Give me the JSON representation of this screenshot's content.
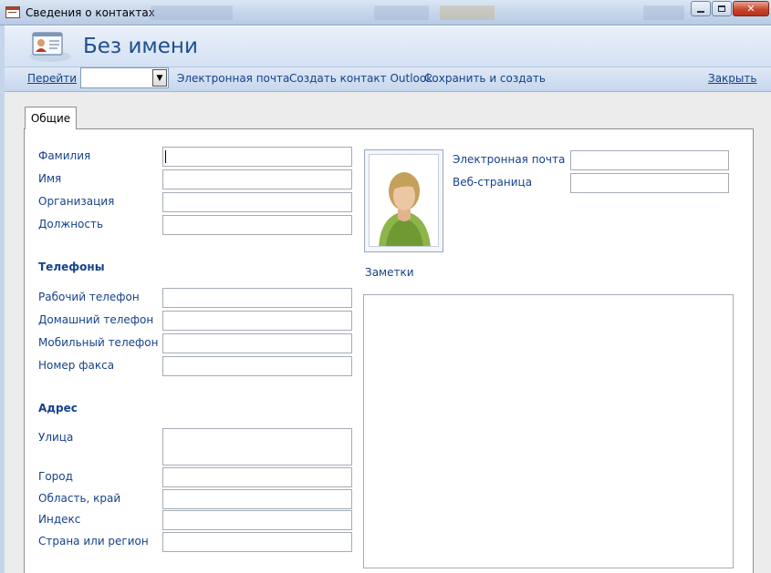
{
  "window": {
    "title": "Сведения о контактах"
  },
  "header": {
    "title": "Без имени"
  },
  "toolbar": {
    "goto_label": "Перейти",
    "goto_value": "",
    "email_label": "Электронная почта",
    "create_outlook_label": "Создать контакт Outlook",
    "save_new_label": "Сохранить и создать",
    "close_label": "Закрыть"
  },
  "tabs": [
    {
      "label": "Общие",
      "active": true
    }
  ],
  "general": {
    "last_name_label": "Фамилия",
    "first_name_label": "Имя",
    "company_label": "Организация",
    "job_title_label": "Должность",
    "last_name": "",
    "first_name": "",
    "company": "",
    "job_title": ""
  },
  "phones": {
    "section_title": "Телефоны",
    "work_label": "Рабочий телефон",
    "home_label": "Домашний телефон",
    "mobile_label": "Мобильный телефон",
    "fax_label": "Номер факса",
    "work": "",
    "home": "",
    "mobile": "",
    "fax": ""
  },
  "address": {
    "section_title": "Адрес",
    "street_label": "Улица",
    "city_label": "Город",
    "region_label": "Область, край",
    "zip_label": "Индекс",
    "country_label": "Страна или регион",
    "street": "",
    "city": "",
    "region": "",
    "zip": "",
    "country": ""
  },
  "contact": {
    "email_label": "Электронная почта",
    "web_label": "Веб-страница",
    "email": "",
    "web": ""
  },
  "notes": {
    "label": "Заметки",
    "value": ""
  },
  "icons": {
    "window": "form-icon",
    "header": "contact-card-icon",
    "photo": "person-photo-icon",
    "combo": "chevron-down-icon"
  },
  "colors": {
    "label_text": "#15428b",
    "header_title": "#1f4f8f",
    "toolbar_bg": "#c7d7ee"
  }
}
